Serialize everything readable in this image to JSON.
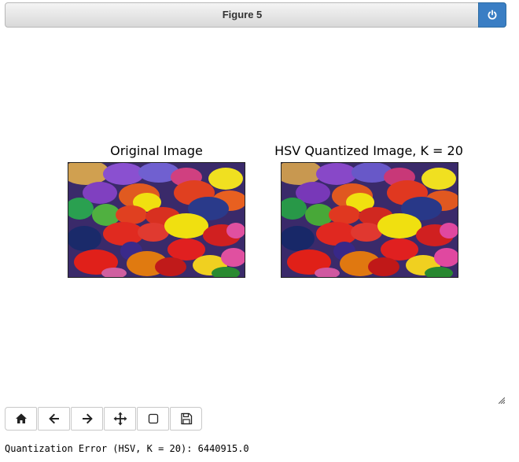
{
  "window": {
    "title": "Figure 5",
    "power_icon": "power-icon"
  },
  "figure": {
    "left_title": "Original Image",
    "right_title": "HSV Quantized Image, K = 20"
  },
  "toolbar": {
    "buttons": [
      {
        "name": "home",
        "icon": "home-icon"
      },
      {
        "name": "back",
        "icon": "arrow-left-icon"
      },
      {
        "name": "forward",
        "icon": "arrow-right-icon"
      },
      {
        "name": "pan",
        "icon": "move-icon"
      },
      {
        "name": "zoom",
        "icon": "zoom-rect-icon"
      },
      {
        "name": "save",
        "icon": "save-icon"
      }
    ]
  },
  "status": {
    "text": "Quantization Error (HSV, K = 20): 6440915.0"
  },
  "colors": {
    "accent": "#3a7ec4"
  }
}
